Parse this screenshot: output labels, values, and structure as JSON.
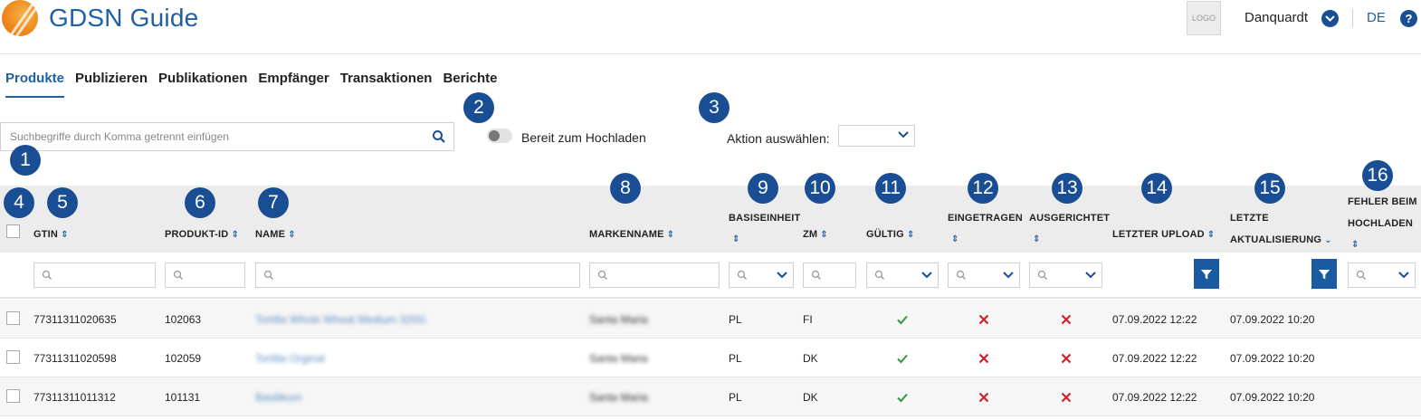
{
  "header": {
    "app_title": "GDSN Guide",
    "logo_placeholder": "LOGO",
    "user_name": "Danquardt",
    "language": "DE",
    "help": "?"
  },
  "nav": {
    "items": [
      {
        "label": "Produkte",
        "active": true
      },
      {
        "label": "Publizieren"
      },
      {
        "label": "Publikationen"
      },
      {
        "label": "Empfänger"
      },
      {
        "label": "Transaktionen"
      },
      {
        "label": "Berichte"
      }
    ]
  },
  "markers": [
    "1",
    "2",
    "3",
    "4",
    "5",
    "6",
    "7",
    "8",
    "9",
    "10",
    "11",
    "12",
    "13",
    "14",
    "15",
    "16"
  ],
  "toolbar": {
    "search_placeholder": "Suchbegriffe durch Komma getrennt einfügen",
    "ready_toggle_label": "Bereit zum Hochladen",
    "action_label": "Aktion auswählen:"
  },
  "table": {
    "columns": {
      "gtin": "GTIN",
      "product_id": "PRODUKT-ID",
      "name": "NAME",
      "brand": "MARKENNAME",
      "base_unit": "BASISEINHEIT",
      "zm": "ZM",
      "valid": "GÜLTIG",
      "registered": "EINGETRAGEN",
      "aligned": "AUSGERICHTET",
      "last_upload": "LETZTER UPLOAD",
      "last_update_1": "LETZTE",
      "last_update_2": "AKTUALISIERUNG",
      "upload_errors_1": "FEHLER BEIM",
      "upload_errors_2": "HOCHLADEN"
    },
    "rows": [
      {
        "gtin": "77311311020635",
        "product_id": "102063",
        "name": "Tortilla Whole Wheat Medium 320G",
        "brand": "Santa Maria",
        "base_unit": "PL",
        "zm": "FI",
        "valid": true,
        "registered": false,
        "aligned": false,
        "last_upload": "07.09.2022 12:22",
        "last_update": "07.09.2022 10:20"
      },
      {
        "gtin": "77311311020598",
        "product_id": "102059",
        "name": "Tortilla Orginal",
        "brand": "Santa Maria",
        "base_unit": "PL",
        "zm": "DK",
        "valid": true,
        "registered": false,
        "aligned": false,
        "last_upload": "07.09.2022 12:22",
        "last_update": "07.09.2022 10:20"
      },
      {
        "gtin": "77311311011312",
        "product_id": "101131",
        "name": "Basilikum",
        "brand": "Santa Maria",
        "base_unit": "PL",
        "zm": "DK",
        "valid": true,
        "registered": false,
        "aligned": false,
        "last_upload": "07.09.2022 12:22",
        "last_update": "07.09.2022 10:20"
      }
    ]
  },
  "colors": {
    "brand_blue": "#1a4e94",
    "link_blue": "#1f5fa6",
    "check_green": "#2e9a3f",
    "cross_red": "#d0202a",
    "header_gray": "#ececec"
  }
}
